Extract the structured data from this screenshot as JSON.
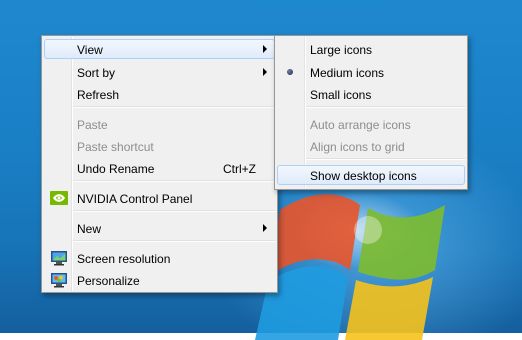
{
  "context_menu": {
    "items": {
      "view": "View",
      "sort_by": "Sort by",
      "refresh": "Refresh",
      "paste": "Paste",
      "paste_shortcut": "Paste shortcut",
      "undo_rename": "Undo Rename",
      "undo_rename_shortcut": "Ctrl+Z",
      "nvidia": "NVIDIA Control Panel",
      "new": "New",
      "screen_resolution": "Screen resolution",
      "personalize": "Personalize"
    }
  },
  "view_submenu": {
    "items": {
      "large_icons": "Large icons",
      "medium_icons": "Medium icons",
      "small_icons": "Small icons",
      "auto_arrange": "Auto arrange icons",
      "align_grid": "Align icons to grid",
      "show_desktop_icons": "Show desktop icons"
    },
    "selected": "Medium icons"
  },
  "icons": {
    "nvidia": "nvidia-logo-icon",
    "screen_resolution": "monitor-icon",
    "personalize": "personalize-monitor-icon"
  },
  "colors": {
    "desktop": "#1a7fc5",
    "menu_background": "#f0f0f0",
    "highlight_border": "#aecff7",
    "disabled_text": "#8d8d8d"
  }
}
